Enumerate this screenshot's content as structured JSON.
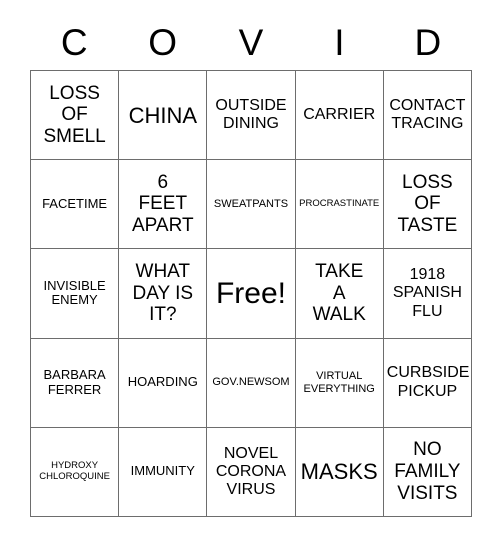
{
  "card": {
    "header_letters": [
      "C",
      "O",
      "V",
      "I",
      "D"
    ],
    "colors": {
      "background": "#ffffff",
      "text": "#000000",
      "border": "#6d6d6d"
    },
    "grid": {
      "columns": 5,
      "rows": 5,
      "cells": [
        {
          "text": "LOSS\nOF\nSMELL",
          "size": "lg",
          "free": false
        },
        {
          "text": "CHINA",
          "size": "xl",
          "free": false
        },
        {
          "text": "OUTSIDE\nDINING",
          "size": "md",
          "free": false
        },
        {
          "text": "CARRIER",
          "size": "md",
          "free": false
        },
        {
          "text": "CONTACT\nTRACING",
          "size": "md",
          "free": false
        },
        {
          "text": "FACETIME",
          "size": "sm",
          "free": false
        },
        {
          "text": "6\nFEET\nAPART",
          "size": "lg",
          "free": false
        },
        {
          "text": "SWEATPANTS",
          "size": "xs",
          "free": false
        },
        {
          "text": "PROCRASTINATE",
          "size": "xxs",
          "free": false
        },
        {
          "text": "LOSS\nOF\nTASTE",
          "size": "lg",
          "free": false
        },
        {
          "text": "INVISIBLE\nENEMY",
          "size": "sm",
          "free": false
        },
        {
          "text": "WHAT\nDAY IS\nIT?",
          "size": "lg",
          "free": false
        },
        {
          "text": "Free!",
          "size": "xxl",
          "free": true
        },
        {
          "text": "TAKE\nA\nWALK",
          "size": "lg",
          "free": false
        },
        {
          "text": "1918\nSPANISH\nFLU",
          "size": "md",
          "free": false
        },
        {
          "text": "BARBARA\nFERRER",
          "size": "sm",
          "free": false
        },
        {
          "text": "HOARDING",
          "size": "sm",
          "free": false
        },
        {
          "text": "GOV.NEWSOM",
          "size": "xs",
          "free": false
        },
        {
          "text": "VIRTUAL\nEVERYTHING",
          "size": "xs",
          "free": false
        },
        {
          "text": "CURBSIDE\nPICKUP",
          "size": "md",
          "free": false
        },
        {
          "text": "HYDROXY\nCHLOROQUINE",
          "size": "xxs",
          "free": false
        },
        {
          "text": "IMMUNITY",
          "size": "sm",
          "free": false
        },
        {
          "text": "NOVEL\nCORONA\nVIRUS",
          "size": "md",
          "free": false
        },
        {
          "text": "MASKS",
          "size": "xl",
          "free": false
        },
        {
          "text": "NO\nFAMILY\nVISITS",
          "size": "lg",
          "free": false
        }
      ]
    }
  }
}
